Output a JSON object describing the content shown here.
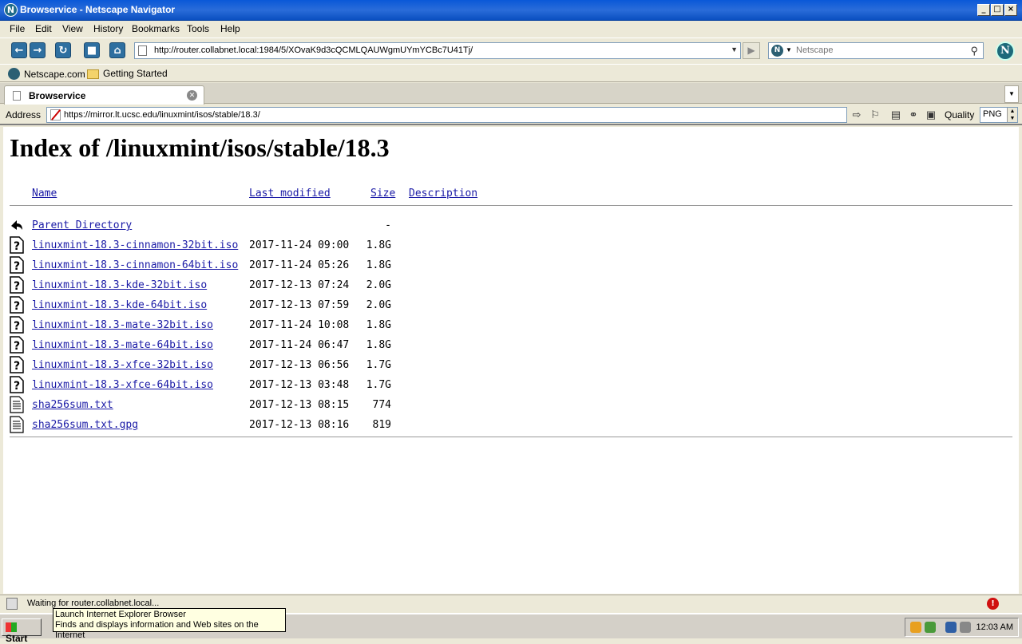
{
  "window": {
    "title": "Browservice - Netscape Navigator",
    "title_icon": "N"
  },
  "menubar": [
    "File",
    "Edit",
    "View",
    "History",
    "Bookmarks",
    "Tools",
    "Help"
  ],
  "navbar": {
    "url": "http://router.collabnet.local:1984/5/XOvaK9d3cQCMLQAUWgmUYmYCBc7U41Tj/",
    "search_placeholder": "Netscape",
    "search_engine": "N",
    "throbber": "N"
  },
  "bookmarks": [
    "Netscape.com",
    "Getting Started"
  ],
  "tabs": [
    {
      "label": "Browservice"
    }
  ],
  "addressbar": {
    "label": "Address",
    "url": "https://mirror.lt.ucsc.edu/linuxmint/isos/stable/18.3/",
    "quality_label": "Quality",
    "quality_value": "PNG"
  },
  "page": {
    "heading": "Index of /linuxmint/isos/stable/18.3",
    "columns": {
      "name": "Name",
      "modified": "Last modified",
      "size": "Size",
      "description": "Description"
    },
    "parent": {
      "name": "Parent Directory",
      "size": "-"
    },
    "files": [
      {
        "name": "linuxmint-18.3-cinnamon-32bit.iso",
        "modified": "2017-11-24 09:00",
        "size": "1.8G",
        "icon": "unknown-file-icon"
      },
      {
        "name": "linuxmint-18.3-cinnamon-64bit.iso",
        "modified": "2017-11-24 05:26",
        "size": "1.8G",
        "icon": "unknown-file-icon"
      },
      {
        "name": "linuxmint-18.3-kde-32bit.iso",
        "modified": "2017-12-13 07:24",
        "size": "2.0G",
        "icon": "unknown-file-icon"
      },
      {
        "name": "linuxmint-18.3-kde-64bit.iso",
        "modified": "2017-12-13 07:59",
        "size": "2.0G",
        "icon": "unknown-file-icon"
      },
      {
        "name": "linuxmint-18.3-mate-32bit.iso",
        "modified": "2017-11-24 10:08",
        "size": "1.8G",
        "icon": "unknown-file-icon"
      },
      {
        "name": "linuxmint-18.3-mate-64bit.iso",
        "modified": "2017-11-24 06:47",
        "size": "1.8G",
        "icon": "unknown-file-icon"
      },
      {
        "name": "linuxmint-18.3-xfce-32bit.iso",
        "modified": "2017-12-13 06:56",
        "size": "1.7G",
        "icon": "unknown-file-icon"
      },
      {
        "name": "linuxmint-18.3-xfce-64bit.iso",
        "modified": "2017-12-13 03:48",
        "size": "1.7G",
        "icon": "unknown-file-icon"
      },
      {
        "name": "sha256sum.txt",
        "modified": "2017-12-13 08:15",
        "size": "774",
        "icon": "text-file-icon"
      },
      {
        "name": "sha256sum.txt.gpg",
        "modified": "2017-12-13 08:16",
        "size": "819",
        "icon": "text-file-icon"
      }
    ]
  },
  "status": {
    "text": "Waiting for router.collabnet.local..."
  },
  "taskbar": {
    "start_label": "Start",
    "clock": "12:03 AM",
    "tooltip_title": "Launch Internet Explorer Browser",
    "tooltip_text": "Finds and displays information and Web sites on the Internet"
  },
  "colors": {
    "link": "#1a1aa6",
    "titlebar": "#0a58d8",
    "chrome": "#ece9d8"
  }
}
